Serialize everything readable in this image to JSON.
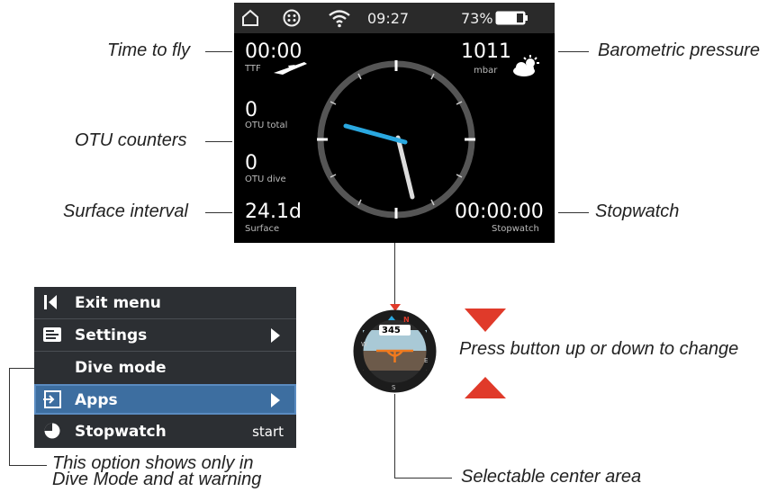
{
  "statusbar": {
    "time": "09:27",
    "battery": "73%"
  },
  "screen": {
    "ttf_value": "00:00",
    "ttf_label": "TTF",
    "pressure_value": "1011",
    "pressure_unit": "mbar",
    "otu_total_value": "0",
    "otu_total_label": "OTU total",
    "otu_dive_value": "0",
    "otu_dive_label": "OTU dive",
    "surface_value": "24.1d",
    "surface_label": "Surface",
    "stopwatch_value": "00:00:00",
    "stopwatch_label": "Stopwatch"
  },
  "callouts": {
    "time_to_fly": "Time to fly",
    "barometric_pressure": "Barometric pressure",
    "otu_counters": "OTU counters",
    "surface_interval": "Surface interval",
    "stopwatch": "Stopwatch",
    "press_button": "Press button up or down to change",
    "selectable_center": "Selectable center area",
    "dive_mode_note_line1": "This option shows only in",
    "dive_mode_note_line2": "Dive Mode and at warning"
  },
  "menu": {
    "items": [
      {
        "label": "Exit menu",
        "icon": "exit-icon"
      },
      {
        "label": "Settings",
        "icon": "settings-icon"
      },
      {
        "label": "Dive mode",
        "icon": ""
      },
      {
        "label": "Apps",
        "icon": "apps-icon",
        "selected": true
      },
      {
        "label": "Stopwatch",
        "icon": "stopwatch-icon",
        "value": "start"
      }
    ]
  },
  "compass": {
    "heading": "345",
    "north": "N"
  },
  "colors": {
    "accent_blue": "#3d6ea0",
    "hand_blue": "#2aa8e0",
    "arrow_red": "#e03a2a",
    "compass_orange": "#f07a1e"
  }
}
